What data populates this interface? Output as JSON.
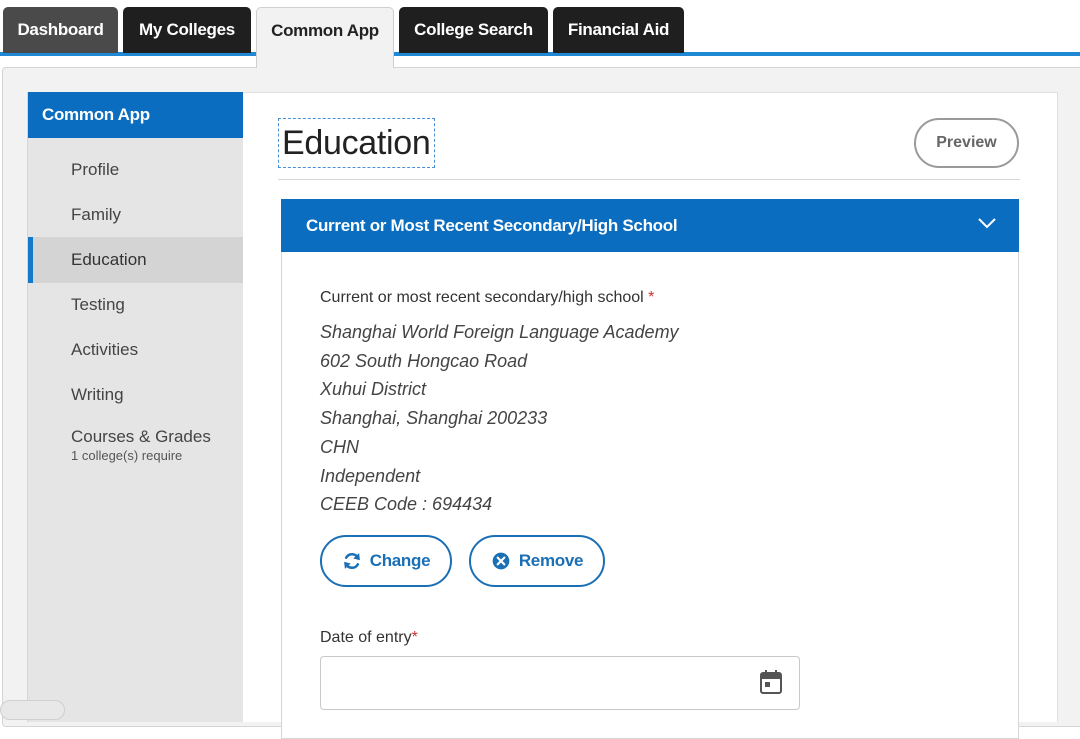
{
  "top_tabs": [
    {
      "label": "Dashboard"
    },
    {
      "label": "My Colleges"
    },
    {
      "label": "Common App"
    },
    {
      "label": "College Search"
    },
    {
      "label": "Financial Aid"
    }
  ],
  "sidebar": {
    "header": "Common App",
    "items": [
      {
        "label": "Profile"
      },
      {
        "label": "Family"
      },
      {
        "label": "Education"
      },
      {
        "label": "Testing"
      },
      {
        "label": "Activities"
      },
      {
        "label": "Writing"
      },
      {
        "label": "Courses & Grades",
        "sub": "1 college(s) require"
      }
    ]
  },
  "main": {
    "title": "Education",
    "preview_label": "Preview",
    "section": {
      "header": "Current or Most Recent Secondary/High School",
      "school_label": "Current or most recent secondary/high school",
      "required_mark": "*",
      "school_lines": [
        "Shanghai World Foreign Language Academy",
        "602 South Hongcao Road",
        "Xuhui District",
        "Shanghai, Shanghai 200233",
        "CHN",
        "Independent",
        "CEEB Code : 694434"
      ],
      "change_label": "Change",
      "remove_label": "Remove",
      "date_label": "Date of entry",
      "date_value": ""
    }
  },
  "colors": {
    "primary_blue": "#0b6dbf",
    "tab_accent": "#1e88d4",
    "required_red": "#d32f2f"
  }
}
